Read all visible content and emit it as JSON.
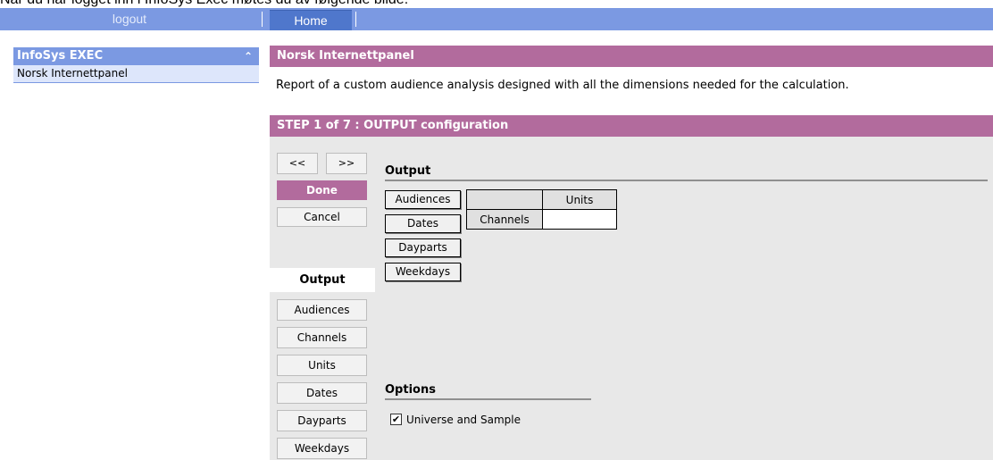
{
  "caption": "Når du har logget inn i InfoSys Exec møtes du av følgende bilde:",
  "topbar": {
    "logout": "logout",
    "home": "Home"
  },
  "sidebar": {
    "title": "InfoSys EXEC",
    "collapse_icon": "⌃",
    "items": [
      {
        "label": "Norsk Internettpanel"
      }
    ]
  },
  "panel": {
    "title": "Norsk Internettpanel",
    "description": "Report of a custom audience analysis designed with all the dimensions needed for the calculation."
  },
  "step": {
    "title": "STEP 1 of 7 : OUTPUT configuration",
    "prev_label": "<<",
    "next_label": ">>",
    "done_label": "Done",
    "cancel_label": "Cancel"
  },
  "tabs": {
    "active": "Output",
    "items": [
      "Audiences",
      "Channels",
      "Units",
      "Dates",
      "Dayparts",
      "Weekdays"
    ]
  },
  "output": {
    "title": "Output",
    "available_dimensions": [
      "Audiences",
      "Dates",
      "Dayparts",
      "Weekdays"
    ],
    "grid": {
      "column_header": "Units",
      "row_header": "Channels"
    }
  },
  "options": {
    "title": "Options",
    "universe_and_sample": {
      "label": "Universe and Sample",
      "checked": true,
      "mark": "✔"
    }
  },
  "colors": {
    "nav_blue": "#7b99e2",
    "home_blue": "#4f77cc",
    "header_purple": "#b26b9d",
    "panel_gray": "#e8e8e8"
  }
}
